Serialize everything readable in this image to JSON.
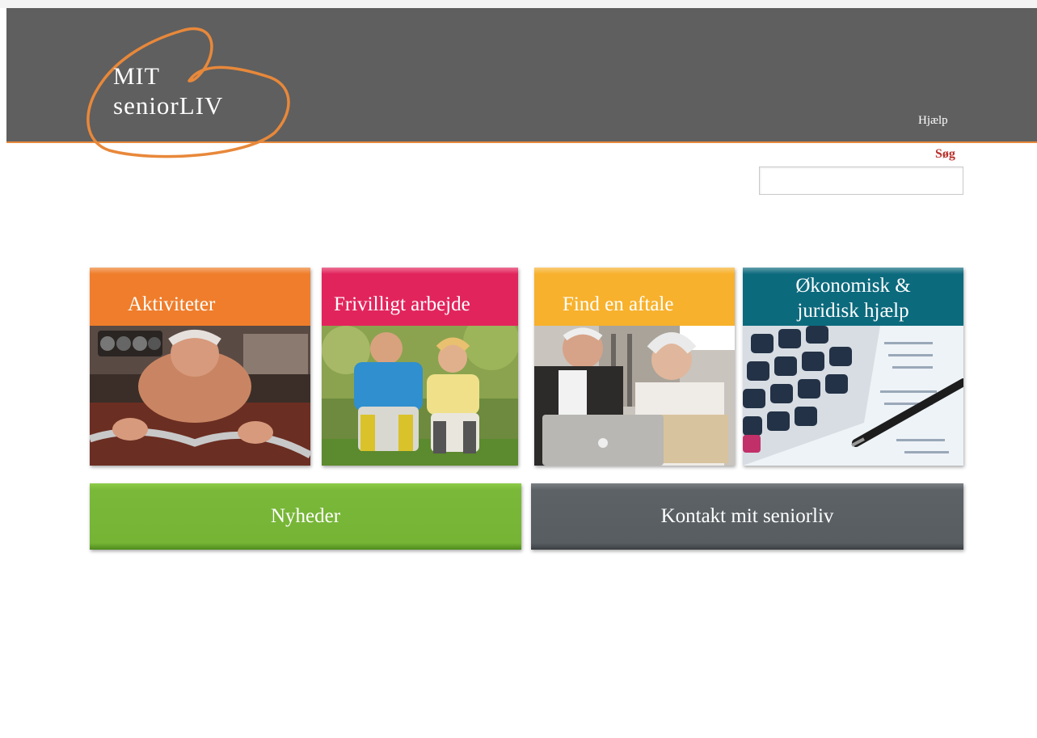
{
  "header": {
    "logo_line1": "MIT",
    "logo_line2": "seniorLIV",
    "help_label": "Hjælp",
    "brand_color": "#5f5f5f",
    "accent_color": "#e8883a"
  },
  "search": {
    "label": "Søg",
    "value": "",
    "placeholder": ""
  },
  "tiles": [
    {
      "label": "Aktiviteter",
      "color": "#ef7d2b",
      "image": "senior-woman-fitness-photo"
    },
    {
      "label": "Frivilligt arbejde",
      "color": "#e2245c",
      "image": "senior-couple-stretching-photo"
    },
    {
      "label": "Find en aftale",
      "color": "#f7b12c",
      "image": "senior-couple-laptop-photo"
    },
    {
      "label_line1": "Økonomisk &",
      "label_line2": "juridisk hjælp",
      "color": "#0c6a7d",
      "image": "calculator-pen-photo"
    }
  ],
  "buttons": {
    "news_label": "Nyheder",
    "news_color": "#7ab83a",
    "contact_label": "Kontakt mit seniorliv",
    "contact_color": "#5c6266"
  }
}
